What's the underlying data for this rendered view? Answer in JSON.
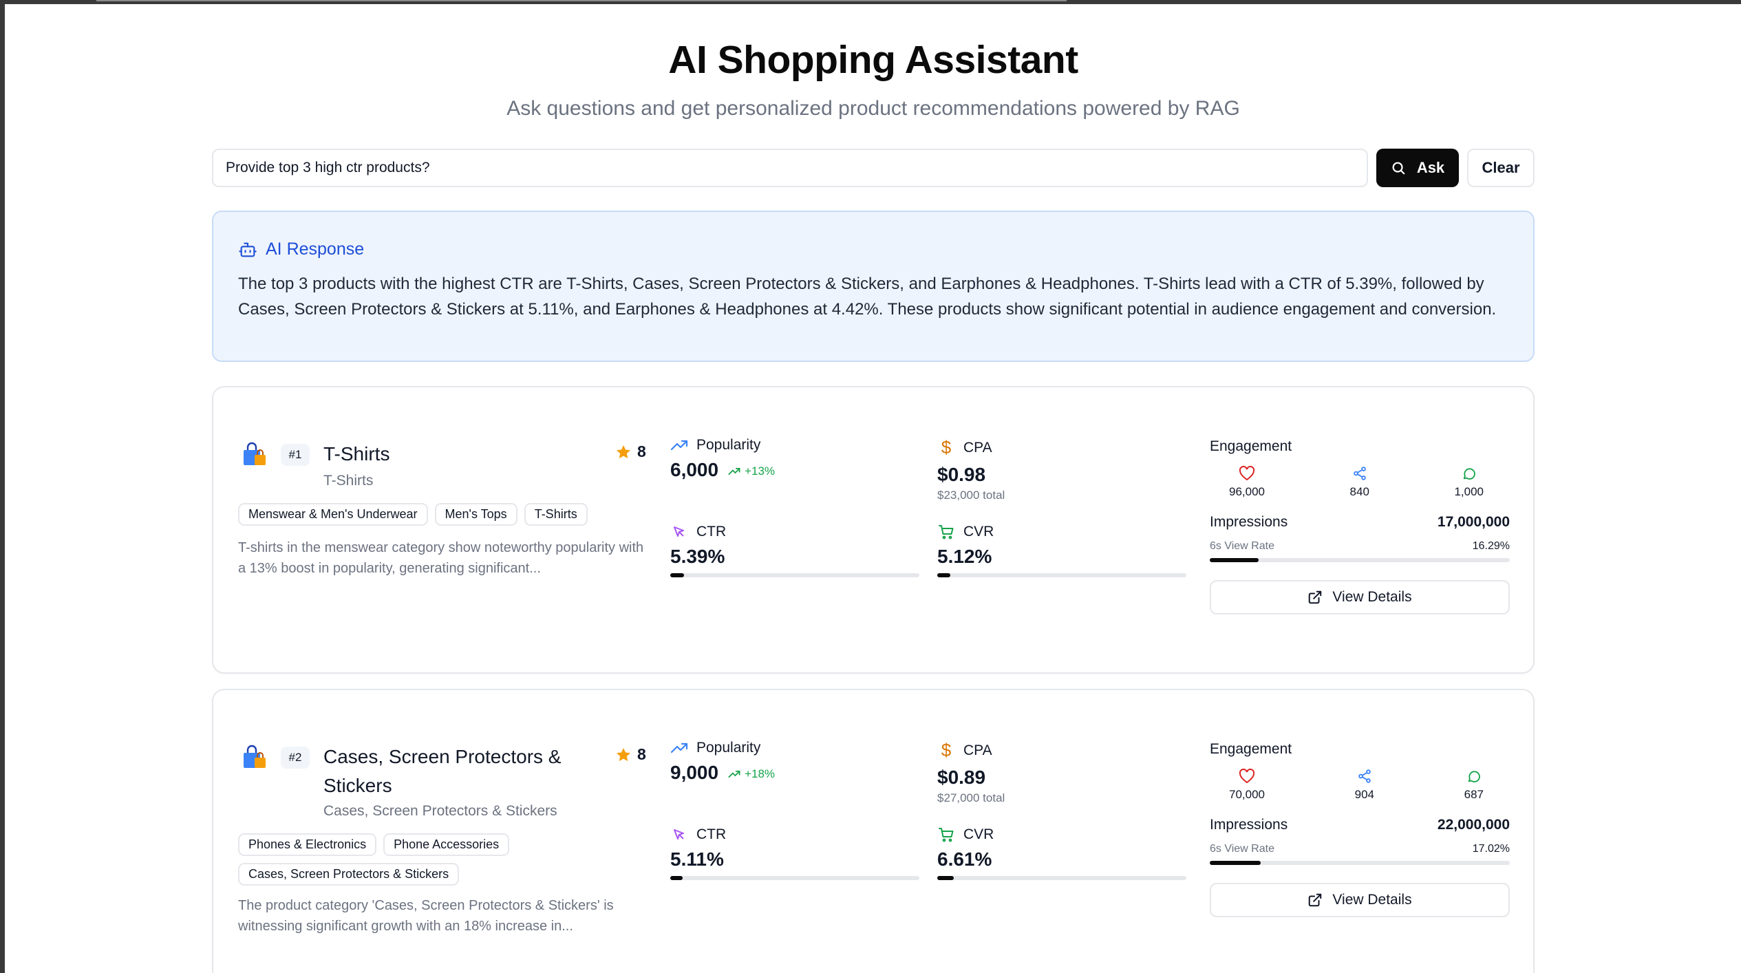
{
  "header": {
    "title": "AI Shopping Assistant",
    "subtitle": "Ask questions and get personalized product recommendations powered by RAG"
  },
  "search": {
    "value": "Provide top 3 high ctr products?",
    "ask_label": "Ask",
    "clear_label": "Clear"
  },
  "ai_response": {
    "label": "AI Response",
    "text": "The top 3 products with the highest CTR are T-Shirts, Cases, Screen Protectors & Stickers, and Earphones & Headphones. T-Shirts lead with a CTR of 5.39%, followed by Cases, Screen Protectors & Stickers at 5.11%, and Earphones & Headphones at 4.42%. These products show significant potential in audience engagement and conversion."
  },
  "labels": {
    "popularity": "Popularity",
    "cpa": "CPA",
    "ctr": "CTR",
    "cvr": "CVR",
    "engagement": "Engagement",
    "impressions": "Impressions",
    "view_rate": "6s View Rate",
    "view_details": "View Details"
  },
  "products": [
    {
      "rank": "#1",
      "name": "T-Shirts",
      "subcategory": "T-Shirts",
      "score": "8",
      "tags": [
        "Menswear & Men's Underwear",
        "Men's Tops",
        "T-Shirts"
      ],
      "description": "T-shirts in the menswear category show noteworthy popularity with a 13% boost in popularity, generating significant...",
      "popularity": "6,000",
      "popularity_trend": "+13%",
      "cpa": "$0.98",
      "cpa_total": "$23,000 total",
      "ctr": "5.39%",
      "ctr_fraction": 0.0539,
      "cvr": "5.12%",
      "cvr_fraction": 0.0512,
      "likes": "96,000",
      "shares": "840",
      "comments": "1,000",
      "impressions": "17,000,000",
      "view_rate": "16.29%",
      "view_rate_fraction": 0.1629
    },
    {
      "rank": "#2",
      "name": "Cases, Screen Protectors & Stickers",
      "subcategory": "Cases, Screen Protectors & Stickers",
      "score": "8",
      "tags": [
        "Phones & Electronics",
        "Phone Accessories",
        "Cases, Screen Protectors & Stickers"
      ],
      "description": "The product category 'Cases, Screen Protectors & Stickers' is witnessing significant growth with an 18% increase in...",
      "popularity": "9,000",
      "popularity_trend": "+18%",
      "cpa": "$0.89",
      "cpa_total": "$27,000 total",
      "ctr": "5.11%",
      "ctr_fraction": 0.0511,
      "cvr": "6.61%",
      "cvr_fraction": 0.0661,
      "likes": "70,000",
      "shares": "904",
      "comments": "687",
      "impressions": "22,000,000",
      "view_rate": "17.02%",
      "view_rate_fraction": 0.1702
    }
  ],
  "colors": {
    "accent_blue": "#1d4ed8",
    "trend_green": "#16a34a",
    "cpa_orange": "#d97706",
    "ctr_purple": "#a855f7",
    "like_red": "#dc2626",
    "share_blue": "#3b82f6",
    "comment_green": "#16a34a",
    "star_amber": "#f59e0b"
  }
}
